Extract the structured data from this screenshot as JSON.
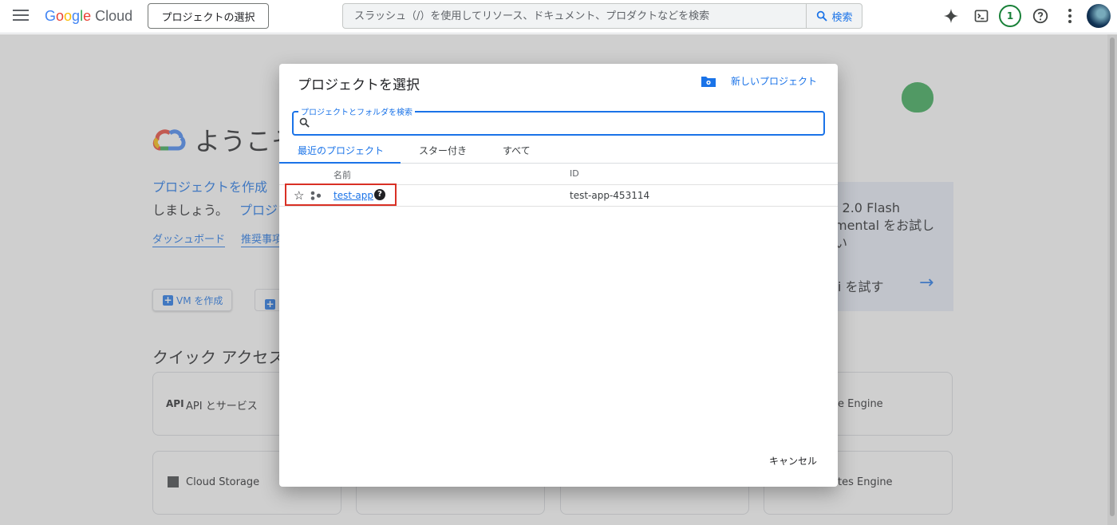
{
  "topbar": {
    "logo_google": [
      "G",
      "o",
      "o",
      "g",
      "l",
      "e"
    ],
    "logo_cloud": "Cloud",
    "project_selector": "プロジェクトの選択",
    "search_placeholder": "スラッシュ（/）を使用してリソース、ドキュメント、プロダクトなどを検索",
    "search_button": "検索",
    "notification_count": "1"
  },
  "background": {
    "welcome": "ようこそ",
    "intro_line1": "プロジェクトを作成",
    "intro_line2": "しましょう。",
    "intro_line2_link": "プロジ",
    "links": [
      "ダッシュボード",
      "推奨事項"
    ],
    "create_vm": "VM を作成",
    "quick_access": "クイック アクセス",
    "cards": [
      "API とサービス",
      "Cloud Storage",
      "e Engine",
      "tes Engine"
    ],
    "gemini_text": "i 2.0 Flash\nmental をお試し\nい",
    "gemini_try": "i を試す"
  },
  "dialog": {
    "title": "プロジェクトを選択",
    "new_project": "新しいプロジェクト",
    "search_label": "プロジェクトとフォルダを検索",
    "search_value": "",
    "tabs": [
      {
        "label": "最近のプロジェクト",
        "active": true
      },
      {
        "label": "スター付き",
        "active": false
      },
      {
        "label": "すべて",
        "active": false
      }
    ],
    "columns": {
      "name": "名前",
      "id": "ID"
    },
    "rows": [
      {
        "name": "test-app",
        "id": "test-app-453114"
      }
    ],
    "cancel": "キャンセル"
  },
  "colors": {
    "accent": "#1a73e8",
    "highlight": "#d93025",
    "badge": "#188038"
  }
}
